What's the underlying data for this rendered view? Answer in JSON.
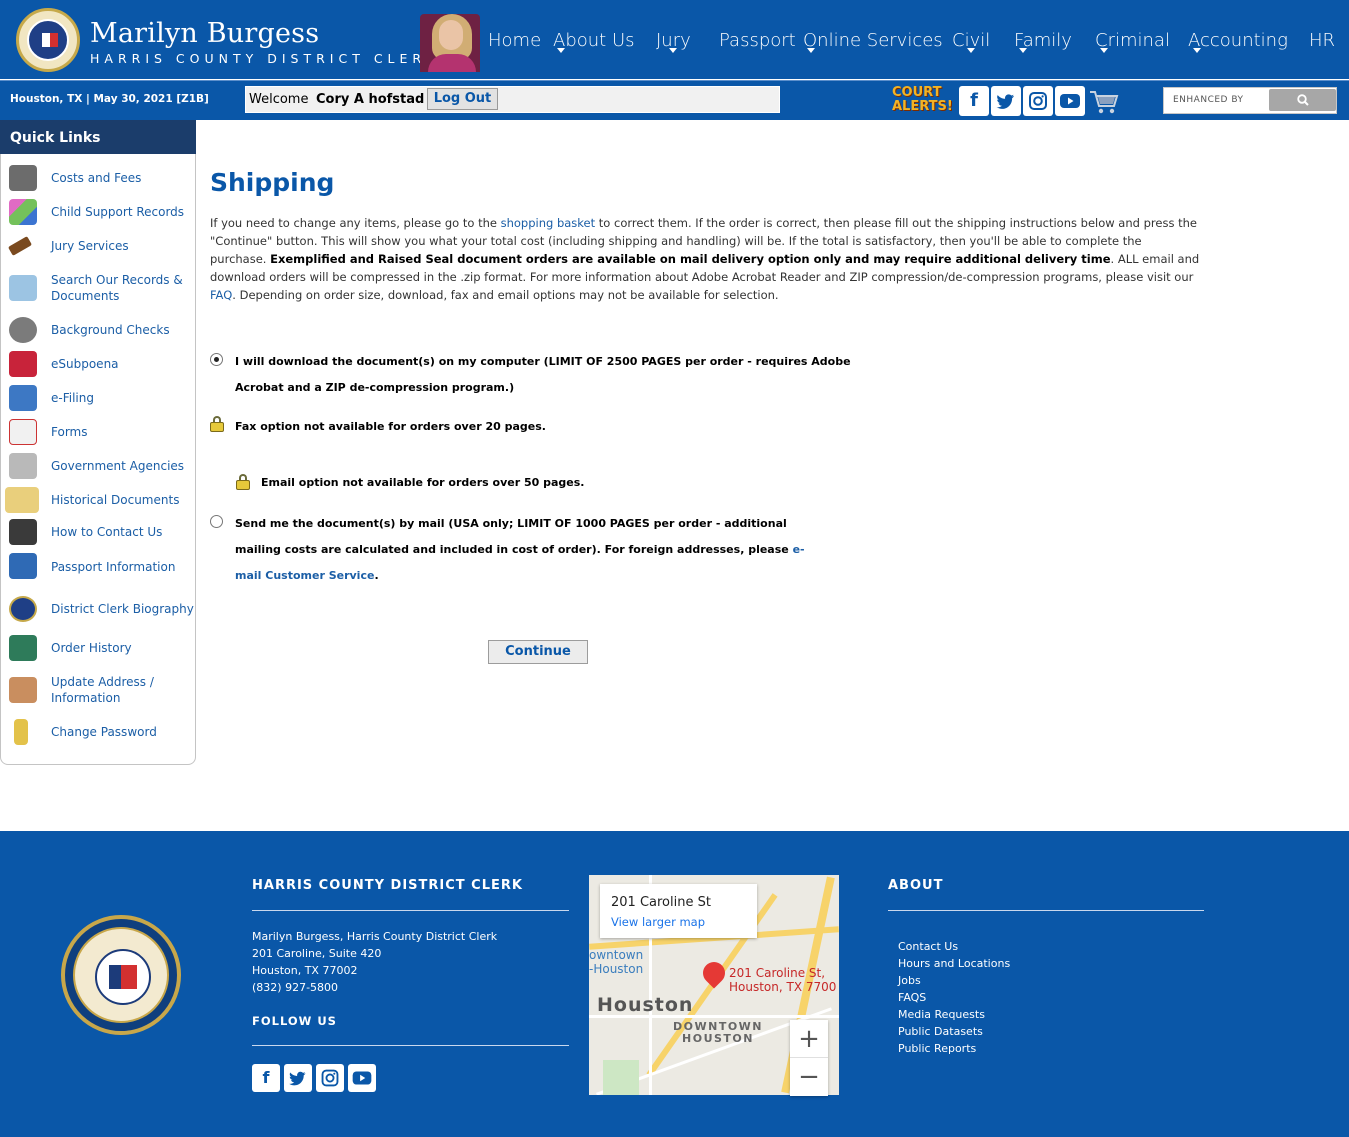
{
  "header": {
    "brand_name": "Marilyn Burgess",
    "brand_sub": "HARRIS COUNTY DISTRICT CLERK",
    "nav": [
      {
        "label": "Home",
        "dropdown": false
      },
      {
        "label": "About Us",
        "dropdown": true
      },
      {
        "label": "Jury",
        "dropdown": true
      },
      {
        "label": "Passport",
        "dropdown": false
      },
      {
        "label": "Online Services",
        "dropdown": true
      },
      {
        "label": "Civil",
        "dropdown": true
      },
      {
        "label": "Family",
        "dropdown": true
      },
      {
        "label": "Criminal",
        "dropdown": true
      },
      {
        "label": "Accounting",
        "dropdown": true
      },
      {
        "label": "HR",
        "dropdown": false
      }
    ]
  },
  "subbar": {
    "date": "Houston, TX | May 30, 2021 [Z1B]",
    "welcome_label": "Welcome",
    "user_name": "Cory A hofstad",
    "logout_label": "Log Out",
    "court_alerts_label": "COURT ALERTS!",
    "search_label": "ENHANCED BY",
    "social_icons": [
      "facebook-icon",
      "twitter-icon",
      "instagram-icon",
      "youtube-icon"
    ]
  },
  "sidebar": {
    "title": "Quick Links",
    "items": [
      {
        "label": "Costs and Fees",
        "icon": "calculator-icon"
      },
      {
        "label": "Child Support Records",
        "icon": "abc-blocks-icon"
      },
      {
        "label": "Jury Services",
        "icon": "gavel-icon"
      },
      {
        "label": "Search Our Records & Documents",
        "icon": "magnifier-documents-icon"
      },
      {
        "label": "Background Checks",
        "icon": "fingerprint-icon"
      },
      {
        "label": "eSubpoena",
        "icon": "subpoena-icon"
      },
      {
        "label": "e-Filing",
        "icon": "laptop-icon"
      },
      {
        "label": "Forms",
        "icon": "form-icon"
      },
      {
        "label": "Government Agencies",
        "icon": "government-building-icon"
      },
      {
        "label": "Historical Documents",
        "icon": "open-book-icon"
      },
      {
        "label": "How to Contact Us",
        "icon": "telephone-icon"
      },
      {
        "label": "Passport Information",
        "icon": "passport-icon"
      },
      {
        "label": "District Clerk Biography",
        "icon": "seal-icon"
      },
      {
        "label": "Order History",
        "icon": "book-icon"
      },
      {
        "label": "Update Address / Information",
        "icon": "person-card-icon"
      },
      {
        "label": "Change Password",
        "icon": "key-icon"
      }
    ]
  },
  "main": {
    "title": "Shipping",
    "intro_1": "If you need to change any items, please go to the ",
    "intro_link": "shopping basket",
    "intro_2": " to correct them.   If the order is correct, then please fill out the shipping instructions below and press the \"Continue\" button.  This will show you what your total cost (including shipping and handling) will be.  If the total is satisfactory, then you'll be able to complete the purchase.   ",
    "intro_bold": "Exemplified and Raised Seal document orders are available on mail delivery option only and may require additional delivery time",
    "intro_3": ".   ALL email and download orders will be compressed in the .zip format.   For more information about Adobe Acrobat Reader and ZIP compression/de-compression programs, please visit our ",
    "intro_faq": "FAQ",
    "intro_4": ".  Depending on order size, download, fax and email options may not be available for selection.",
    "option_download": "I will download the document(s) on my computer (LIMIT OF 2500 PAGES per order - requires Adobe Acrobat and a ZIP de-compression program.)",
    "option_fax": "Fax option not available for orders over 20 pages.",
    "option_email": "Email option not available for orders over 50 pages.",
    "option_mail_1": "Send me the document(s) by mail (USA only; LIMIT OF 1000 PAGES per order - additional mailing costs are calculated and included in cost of order). For foreign addresses, please ",
    "option_mail_link": "e-mail Customer Service",
    "option_mail_2": ".",
    "selected_option": "download",
    "continue_label": "Continue"
  },
  "footer": {
    "org_heading": "HARRIS COUNTY DISTRICT CLERK",
    "address_lines": [
      "Marilyn Burgess, Harris County District Clerk",
      "201 Caroline, Suite 420",
      "Houston, TX 77002",
      "(832) 927-5800"
    ],
    "follow_heading": "FOLLOW US",
    "map": {
      "card_address": "201 Caroline St",
      "card_link": "View larger map",
      "pin_label_1": "201 Caroline St,",
      "pin_label_2": "Houston, TX 7700",
      "city": "Houston",
      "downtown_1": "DOWNTOWN",
      "downtown_2": "HOUSTON",
      "poi_1": "owntown",
      "poi_2": "-Houston",
      "zoom_in": "+",
      "zoom_out": "−"
    },
    "about_heading": "ABOUT",
    "about_links": [
      "Contact Us",
      "Hours and Locations",
      "Jobs",
      "FAQS",
      "Media Requests",
      "Public Datasets",
      "Public Reports"
    ]
  },
  "colors": {
    "brand_blue": "#0a57a8",
    "sidebar_head": "#1b3d6b",
    "link": "#1b5ea6",
    "alert_yellow": "#f3b324"
  }
}
